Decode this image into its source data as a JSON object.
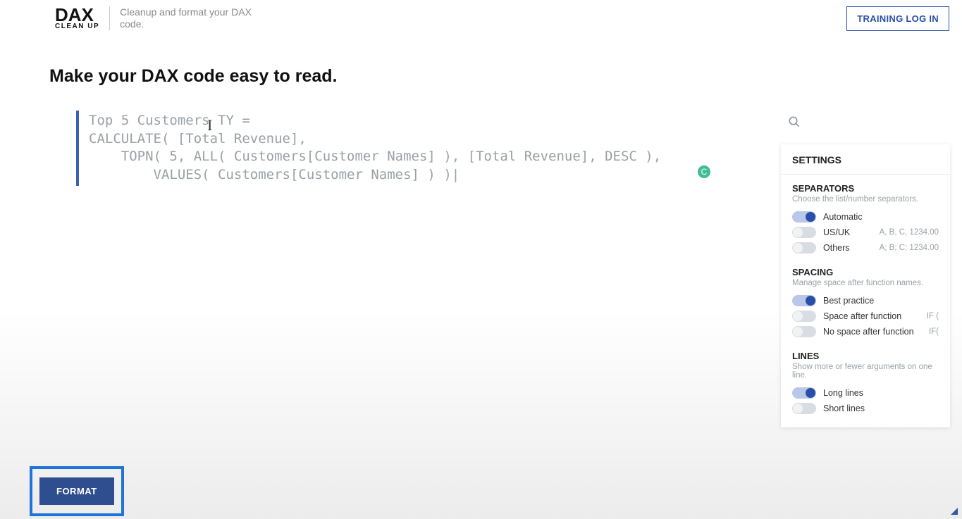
{
  "header": {
    "logo_main": "DAX",
    "logo_sub": "CLEAN UP",
    "tagline": "Cleanup and format your DAX code.",
    "login_label": "TRAINING LOG IN"
  },
  "headline": "Make your DAX code easy to read.",
  "code": "Top 5 Customers TY =\nCALCULATE( [Total Revenue],\n    TOPN( 5, ALL( Customers[Customer Names] ), [Total Revenue], DESC ),\n        VALUES( Customers[Customer Names] ) )|",
  "status_indicator": "C",
  "settings": {
    "title": "SETTINGS",
    "separators": {
      "title": "SEPARATORS",
      "desc": "Choose the list/number separators.",
      "options": {
        "auto": {
          "label": "Automatic",
          "on": true
        },
        "usuk": {
          "label": "US/UK",
          "hint": "A, B, C, 1234.00",
          "on": false
        },
        "others": {
          "label": "Others",
          "hint": "A; B; C; 1234.00",
          "on": false
        }
      }
    },
    "spacing": {
      "title": "SPACING",
      "desc": "Manage space after function names.",
      "options": {
        "best": {
          "label": "Best practice",
          "on": true
        },
        "space": {
          "label": "Space after function",
          "hint": "IF (",
          "on": false
        },
        "nospace": {
          "label": "No space after function",
          "hint": "IF(",
          "on": false
        }
      }
    },
    "lines": {
      "title": "LINES",
      "desc": "Show more or fewer arguments on one line.",
      "options": {
        "long": {
          "label": "Long lines",
          "on": true
        },
        "short": {
          "label": "Short lines",
          "on": false
        }
      }
    }
  },
  "format_button": "FORMAT"
}
